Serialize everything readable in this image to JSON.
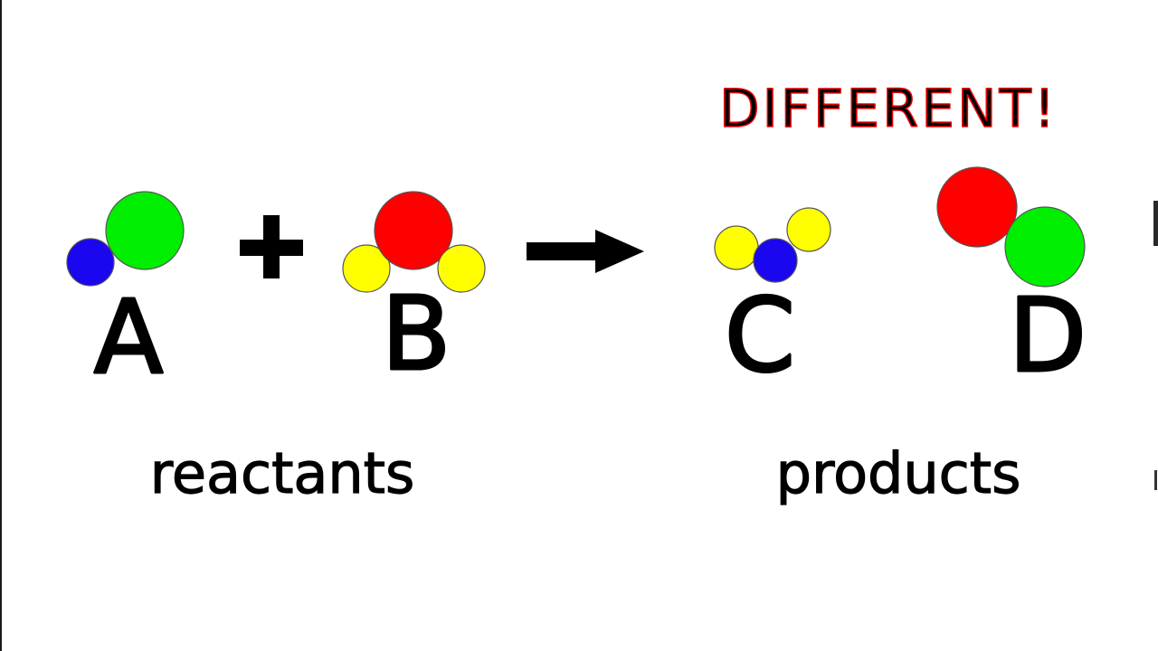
{
  "colors": {
    "green": "#00ee00",
    "blue": "#1a06ef",
    "red": "#ff0000",
    "yellow": "#ffff00",
    "ink": "#000000",
    "emphasis": "#ee0000"
  },
  "annotation": {
    "text": "DIFFERENT!"
  },
  "equation": {
    "plus_symbol": "plus",
    "arrow_symbol": "right-arrow",
    "molecules": [
      {
        "label": "A",
        "atoms": [
          "blue",
          "green"
        ]
      },
      {
        "label": "B",
        "atoms": [
          "yellow",
          "red",
          "yellow"
        ]
      },
      {
        "label": "C",
        "atoms": [
          "yellow",
          "blue",
          "yellow"
        ]
      },
      {
        "label": "D",
        "atoms": [
          "red",
          "green"
        ]
      }
    ]
  },
  "groups": {
    "reactants_label": "reactants",
    "products_label": "products"
  }
}
